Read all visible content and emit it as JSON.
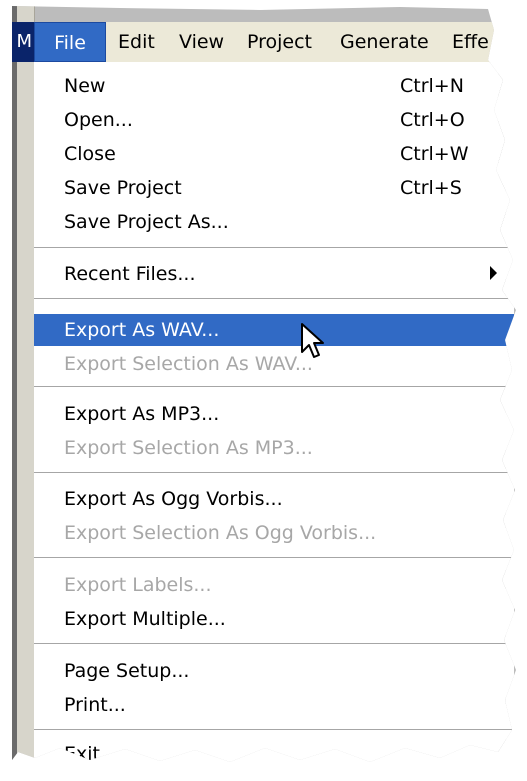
{
  "menubar": {
    "app_icon_glyph": "M",
    "items": [
      "File",
      "Edit",
      "View",
      "Project",
      "Generate",
      "Effe"
    ]
  },
  "file_menu": {
    "new": {
      "label": "New",
      "shortcut": "Ctrl+N"
    },
    "open": {
      "label": "Open...",
      "shortcut": "Ctrl+O"
    },
    "close": {
      "label": "Close",
      "shortcut": "Ctrl+W"
    },
    "save_project": {
      "label": "Save Project",
      "shortcut": "Ctrl+S"
    },
    "save_project_as": {
      "label": "Save Project As..."
    },
    "recent_files": {
      "label": "Recent Files..."
    },
    "export_wav": {
      "label": "Export As WAV..."
    },
    "export_selection_wav": {
      "label": "Export Selection As WAV..."
    },
    "export_mp3": {
      "label": "Export As MP3..."
    },
    "export_selection_mp3": {
      "label": "Export Selection As MP3..."
    },
    "export_ogg": {
      "label": "Export As Ogg Vorbis..."
    },
    "export_selection_ogg": {
      "label": "Export Selection As Ogg Vorbis..."
    },
    "export_labels": {
      "label": "Export Labels..."
    },
    "export_multiple": {
      "label": "Export Multiple..."
    },
    "page_setup": {
      "label": "Page Setup..."
    },
    "print": {
      "label": "Print..."
    },
    "exit": {
      "label": "Exit"
    }
  },
  "colors": {
    "highlight": "#316ac5",
    "menubar_bg": "#ece9d8",
    "disabled_text": "#a7a7a7"
  },
  "icons": {
    "pointer": "arrow-cursor-icon",
    "submenu": "submenu-arrow-icon"
  }
}
